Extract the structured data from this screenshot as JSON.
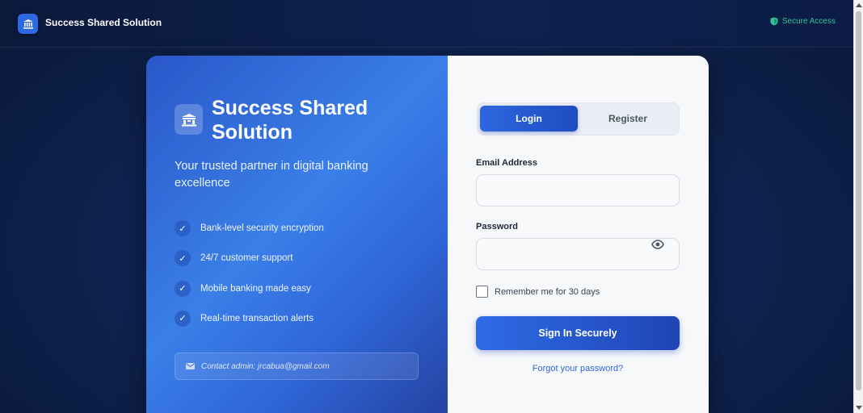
{
  "header": {
    "brand_name": "Success Shared Solution",
    "secure_label": "Secure Access",
    "logo_icon": "bank-icon",
    "secure_icon": "shield-icon"
  },
  "hero": {
    "title": "Success Shared Solution",
    "subtitle": "Your trusted partner in digital banking excellence",
    "icon": "bank-building-icon",
    "features": [
      "Bank-level security encryption",
      "24/7 customer support",
      "Mobile banking made easy",
      "Real-time transaction alerts"
    ],
    "check_glyph": "✓",
    "contact_text": "Contact admin: jrcabua@gmail.com",
    "contact_icon": "envelope-icon"
  },
  "form": {
    "tabs": {
      "login": "Login",
      "register": "Register",
      "active": "login"
    },
    "email_label": "Email Address",
    "email_value": "",
    "password_label": "Password",
    "password_value": "",
    "remember_label": "Remember me for 30 days",
    "remember_checked": false,
    "submit_label": "Sign In Securely",
    "forgot_label": "Forgot your password?"
  },
  "colors": {
    "accent": "#2f66e0",
    "secure_green": "#34c29a",
    "link": "#2f66d8"
  }
}
